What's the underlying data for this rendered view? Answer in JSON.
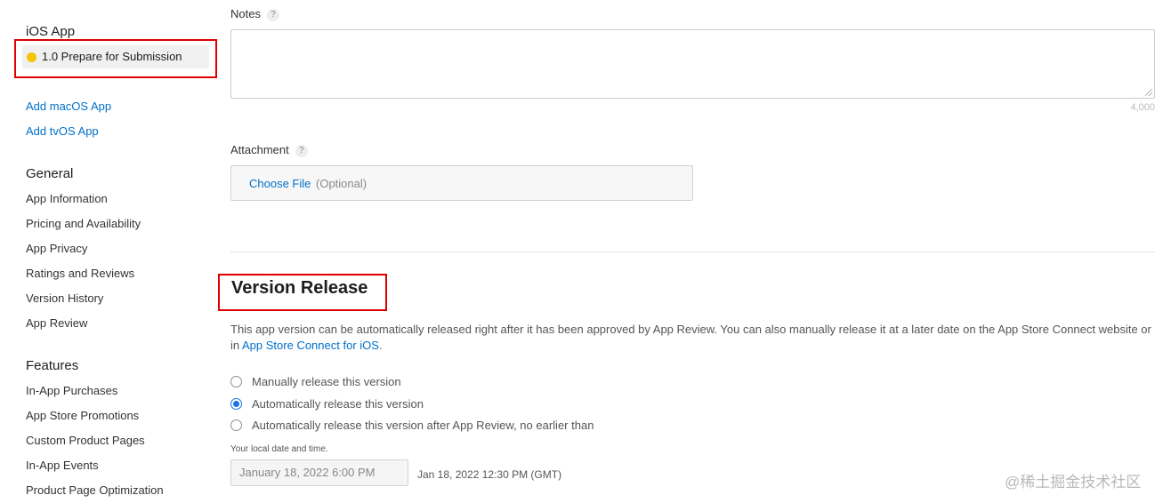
{
  "sidebar": {
    "ios_heading": "iOS App",
    "version_item": "1.0 Prepare for Submission",
    "status_color": "#f5c400",
    "add_links": [
      "Add macOS App",
      "Add tvOS App"
    ],
    "general_heading": "General",
    "general_items": [
      "App Information",
      "Pricing and Availability",
      "App Privacy",
      "Ratings and Reviews",
      "Version History",
      "App Review"
    ],
    "features_heading": "Features",
    "features_items": [
      "In-App Purchases",
      "App Store Promotions",
      "Custom Product Pages",
      "In-App Events",
      "Product Page Optimization"
    ]
  },
  "notes": {
    "label": "Notes",
    "help": "?",
    "value": "",
    "char_limit": "4,000"
  },
  "attachment": {
    "label": "Attachment",
    "help": "?",
    "choose_file": "Choose File",
    "optional": "(Optional)"
  },
  "version_release": {
    "title": "Version Release",
    "description": "This app version can be automatically released right after it has been approved by App Review. You can also manually release it at a later date on the App Store Connect website or in ",
    "description_link": "App Store Connect for iOS",
    "description_end": ".",
    "options": [
      "Manually release this version",
      "Automatically release this version",
      "Automatically release this version after App Review, no earlier than"
    ],
    "selected_option": "Automatically release this version",
    "local_note": "Your local date and time.",
    "date_value": "January 18, 2022 6:00 PM",
    "gmt_value": "Jan 18, 2022 12:30 PM (GMT)"
  },
  "watermark": "@稀土掘金技术社区",
  "colors": {
    "link": "#0070c9",
    "highlight": "#e10000",
    "radio_selected": "#1a73e8"
  }
}
